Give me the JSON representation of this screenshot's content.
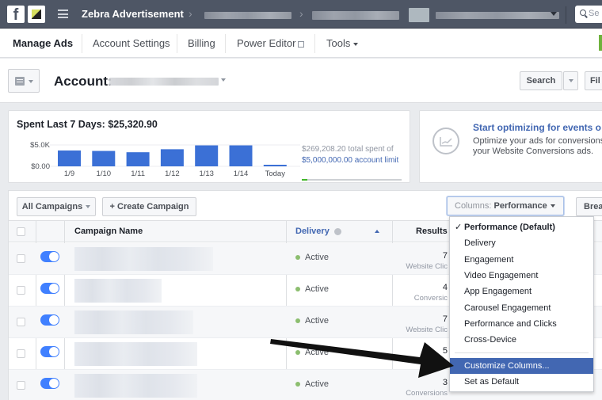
{
  "topbar": {
    "brand": "Zebra Advertisement",
    "search_placeholder": "Se"
  },
  "nav": {
    "items": [
      {
        "label": "Manage Ads",
        "active": true
      },
      {
        "label": "Account Settings"
      },
      {
        "label": "Billing"
      },
      {
        "label": "Power Editor"
      },
      {
        "label": "Tools"
      }
    ]
  },
  "account": {
    "label": "Account:"
  },
  "actions": {
    "search": "Search",
    "filter": "Fil"
  },
  "spend": {
    "title": "Spent Last 7 Days: $25,320.90",
    "total_text": "$269,208.20 total spent of",
    "limit_link": "$5,000,000.00 account limit",
    "limit_progress": 0.054
  },
  "chart_data": {
    "type": "bar",
    "title": "Spent Last 7 Days: $25,320.90",
    "categories": [
      "1/9",
      "1/10",
      "1/11",
      "1/12",
      "1/13",
      "1/14",
      "Today"
    ],
    "values": [
      3700,
      3600,
      3300,
      4000,
      4900,
      4900,
      150
    ],
    "ytick_labels": [
      "$5.0K",
      "$0.00"
    ],
    "ylim": [
      0,
      5000
    ],
    "color": "#3b70d6"
  },
  "optimize": {
    "title": "Start optimizing for events o",
    "desc_line1": "Optimize your ads for conversions b",
    "desc_line2": "your Website Conversions ads."
  },
  "table": {
    "all_campaigns": "All Campaigns",
    "create_campaign": "+ Create Campaign",
    "columns_prefix": "Columns:",
    "columns_value": "Performance",
    "breakdown": "Breakd",
    "headers": {
      "name": "Campaign Name",
      "delivery": "Delivery",
      "results": "Results"
    },
    "rows": [
      {
        "status": "Active",
        "result": "7",
        "result_type": "Website Clic"
      },
      {
        "status": "Active",
        "result": "4",
        "result_type": "Conversic"
      },
      {
        "status": "Active",
        "result": "7",
        "result_type": "Website Clic"
      },
      {
        "status": "Active",
        "result": "5",
        "result_type": ""
      },
      {
        "status": "Active",
        "result": "3",
        "result_type": "Conversions"
      }
    ]
  },
  "columns_menu": {
    "items": [
      {
        "label": "Performance (Default)",
        "checked": true
      },
      {
        "label": "Delivery"
      },
      {
        "label": "Engagement"
      },
      {
        "label": "Video Engagement"
      },
      {
        "label": "App Engagement"
      },
      {
        "label": "Carousel Engagement"
      },
      {
        "label": "Performance and Clicks"
      },
      {
        "label": "Cross-Device"
      }
    ],
    "customize": "Customize Columns...",
    "set_default": "Set as Default",
    "check_glyph": "✓"
  }
}
